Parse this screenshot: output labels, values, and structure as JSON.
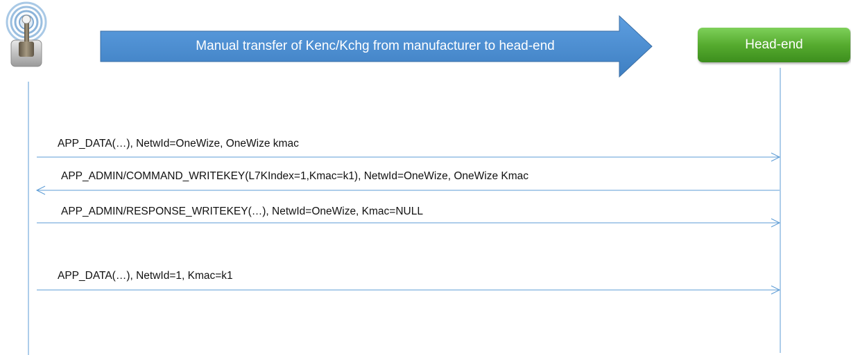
{
  "banner": {
    "label": "Manual transfer of Kenc/Kchg from manufacturer to head-end"
  },
  "participants": {
    "headend": {
      "label": "Head-end"
    },
    "meter": {
      "icon": "antenna-device-icon"
    }
  },
  "messages": [
    {
      "label": "APP_DATA(…), NetwId=OneWize, OneWize kmac",
      "direction": "right"
    },
    {
      "label": "APP_ADMIN/COMMAND_WRITEKEY(L7KIndex=1,Kmac=k1), NetwId=OneWize, OneWize Kmac",
      "direction": "left"
    },
    {
      "label": "APP_ADMIN/RESPONSE_WRITEKEY(…), NetwId=OneWize, Kmac=NULL",
      "direction": "right"
    },
    {
      "label": "APP_DATA(…), NetwId=1, Kmac=k1",
      "direction": "right"
    }
  ],
  "colors": {
    "arrow_blue": "#4f8fd0",
    "line_blue": "#5b9bd5",
    "headend_green": "#56ab2f"
  }
}
